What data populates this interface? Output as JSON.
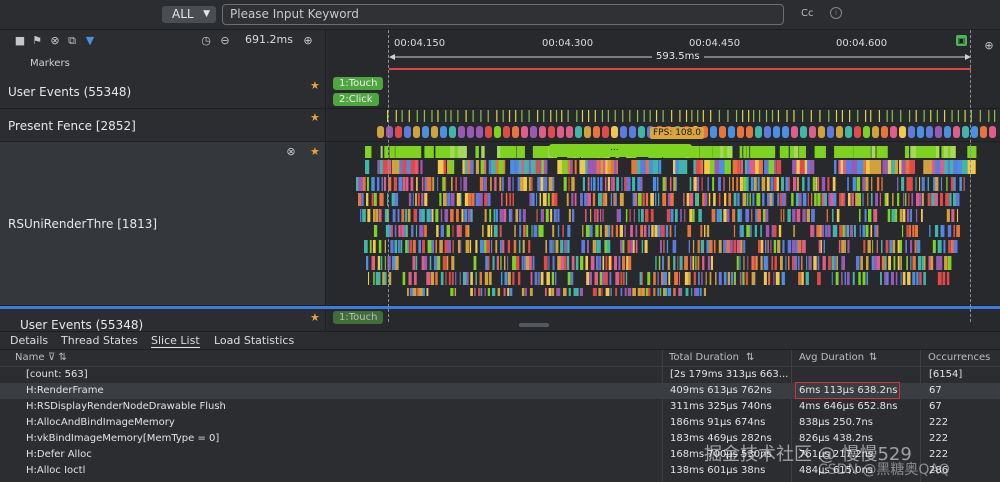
{
  "toolbar": {
    "filter_value": "ALL",
    "search_placeholder": "Please Input Keyword",
    "cc_label": "Cc",
    "zoom_value": "691.2ms"
  },
  "markers_label": "Markers",
  "ruler": {
    "ticks": [
      "00:04.150",
      "00:04.300",
      "00:04.450",
      "00:04.600"
    ],
    "span_label": "593.5ms"
  },
  "rows": {
    "user_events": "User Events (55348)",
    "present_fence": "Present Fence [2852]",
    "render_thread": "RSUniRenderThre [1813]",
    "user_events_bottom": "User Events (55348)"
  },
  "events": {
    "touch": "1:Touch",
    "click": "2:Click",
    "touch_bottom": "1:Touch",
    "fps": "FPS: 108.0",
    "ellipsis": "..."
  },
  "tabs": [
    "Details",
    "Thread States",
    "Slice List",
    "Load Statistics"
  ],
  "table": {
    "headers": [
      "Name",
      "Total Duration",
      "Avg Duration",
      "Occurrences"
    ],
    "rows": [
      {
        "name": "[count: 563]",
        "total": "[2s 179ms 313µs 663...",
        "avg": "",
        "occ": "[6154]"
      },
      {
        "name": "H:RenderFrame",
        "total": "409ms 613µs 762ns",
        "avg": "6ms 113µs 638.2ns",
        "occ": "67"
      },
      {
        "name": "H:RSDisplayRenderNodeDrawable Flush",
        "total": "311ms 325µs 740ns",
        "avg": "4ms 646µs 652.8ns",
        "occ": "67"
      },
      {
        "name": "H:AllocAndBindImageMemory",
        "total": "186ms 91µs 674ns",
        "avg": "838µs 250.7ns",
        "occ": "222"
      },
      {
        "name": "H:vkBindImageMemory[MemType = 0]",
        "total": "183ms 469µs 282ns",
        "avg": "826µs 438.2ns",
        "occ": "222"
      },
      {
        "name": "H:Defer Alloc",
        "total": "168ms 700µs 530ns",
        "avg": "761µs 217.2ns",
        "occ": "222"
      },
      {
        "name": "H:Alloc Ioctl",
        "total": "138ms 601µs 38ns",
        "avg": "484µs 615.0ns",
        "occ": "286"
      }
    ]
  },
  "watermark": {
    "text1": "掘金技术社区 @ 慢慢529",
    "text2": "CSDN @黑糖奥QAQ"
  },
  "colors": {
    "accent_blue": "#3d7be0",
    "event_green": "#4fa53f",
    "fps_gold": "#d9a43a",
    "highlight_red": "#c93636"
  }
}
